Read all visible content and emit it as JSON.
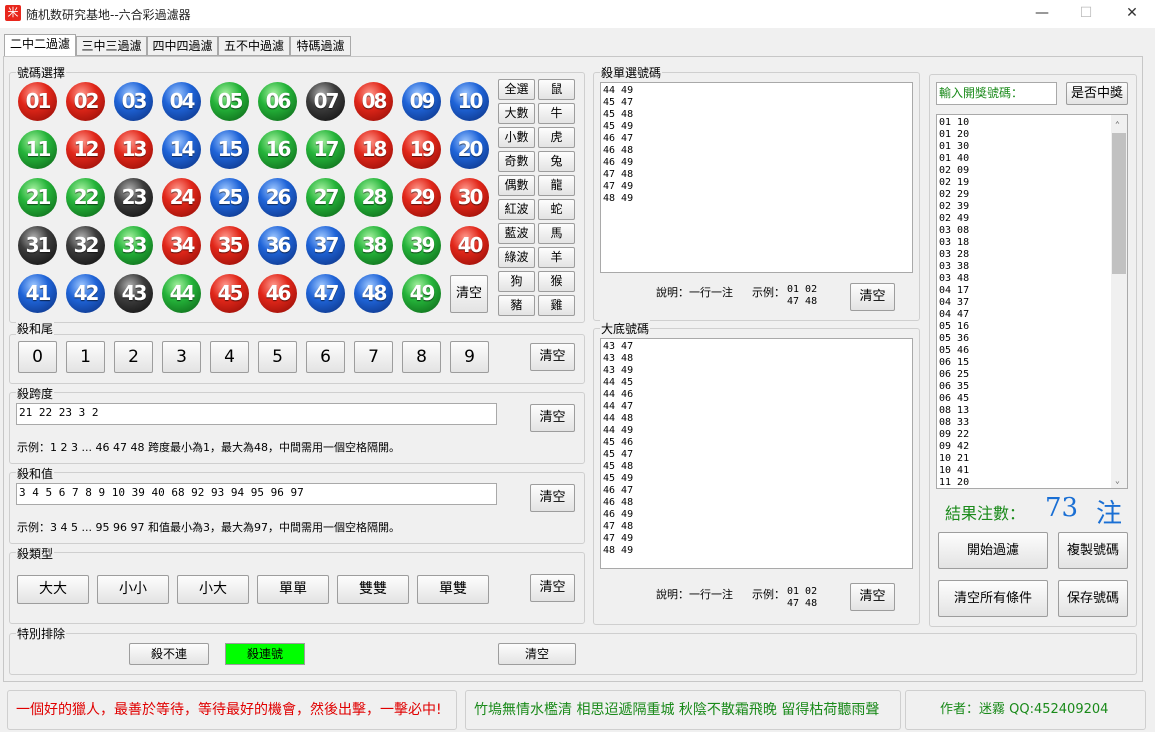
{
  "app": {
    "icon_glyph": "米",
    "title": "随机数研究基地--六合彩過濾器",
    "minimize_glyph": "—",
    "maximize_glyph": "☐",
    "close_glyph": "✕"
  },
  "tabs": [
    "二中二過濾",
    "三中三過濾",
    "四中四過濾",
    "五不中過濾",
    "特碼過濾"
  ],
  "number_select": {
    "label": "號碼選擇",
    "balls": [
      {
        "n": "01",
        "c": "red"
      },
      {
        "n": "02",
        "c": "red"
      },
      {
        "n": "03",
        "c": "blue"
      },
      {
        "n": "04",
        "c": "blue"
      },
      {
        "n": "05",
        "c": "green"
      },
      {
        "n": "06",
        "c": "green"
      },
      {
        "n": "07",
        "c": "black"
      },
      {
        "n": "08",
        "c": "red"
      },
      {
        "n": "09",
        "c": "blue"
      },
      {
        "n": "10",
        "c": "blue"
      },
      {
        "n": "11",
        "c": "green"
      },
      {
        "n": "12",
        "c": "red"
      },
      {
        "n": "13",
        "c": "red"
      },
      {
        "n": "14",
        "c": "blue"
      },
      {
        "n": "15",
        "c": "blue"
      },
      {
        "n": "16",
        "c": "green"
      },
      {
        "n": "17",
        "c": "green"
      },
      {
        "n": "18",
        "c": "red"
      },
      {
        "n": "19",
        "c": "red"
      },
      {
        "n": "20",
        "c": "blue"
      },
      {
        "n": "21",
        "c": "green"
      },
      {
        "n": "22",
        "c": "green"
      },
      {
        "n": "23",
        "c": "black"
      },
      {
        "n": "24",
        "c": "red"
      },
      {
        "n": "25",
        "c": "blue"
      },
      {
        "n": "26",
        "c": "blue"
      },
      {
        "n": "27",
        "c": "green"
      },
      {
        "n": "28",
        "c": "green"
      },
      {
        "n": "29",
        "c": "red"
      },
      {
        "n": "30",
        "c": "red"
      },
      {
        "n": "31",
        "c": "black"
      },
      {
        "n": "32",
        "c": "black"
      },
      {
        "n": "33",
        "c": "green"
      },
      {
        "n": "34",
        "c": "red"
      },
      {
        "n": "35",
        "c": "red"
      },
      {
        "n": "36",
        "c": "blue"
      },
      {
        "n": "37",
        "c": "blue"
      },
      {
        "n": "38",
        "c": "green"
      },
      {
        "n": "39",
        "c": "green"
      },
      {
        "n": "40",
        "c": "red"
      },
      {
        "n": "41",
        "c": "blue"
      },
      {
        "n": "42",
        "c": "blue"
      },
      {
        "n": "43",
        "c": "black"
      },
      {
        "n": "44",
        "c": "green"
      },
      {
        "n": "45",
        "c": "red"
      },
      {
        "n": "46",
        "c": "red"
      },
      {
        "n": "47",
        "c": "blue"
      },
      {
        "n": "48",
        "c": "blue"
      },
      {
        "n": "49",
        "c": "green"
      }
    ],
    "clear_label": "清空",
    "group_buttons": [
      "全選",
      "鼠",
      "大數",
      "牛",
      "小數",
      "虎",
      "奇數",
      "兔",
      "偶數",
      "龍",
      "紅波",
      "蛇",
      "藍波",
      "馬",
      "綠波",
      "羊",
      "狗",
      "猴",
      "豬",
      "雞"
    ]
  },
  "kill_tail": {
    "label": "殺和尾",
    "digits": [
      "0",
      "1",
      "2",
      "3",
      "4",
      "5",
      "6",
      "7",
      "8",
      "9"
    ],
    "clear_label": "清空"
  },
  "kill_span": {
    "label": "殺跨度",
    "value": "21 22 23 3 2",
    "clear_label": "清空",
    "note": "示例：1 2 3 ... 46 47 48 跨度最小為1，最大為48，中間需用一個空格隔開。"
  },
  "kill_sum": {
    "label": "殺和值",
    "value": "3 4 5 6 7 8 9 10 39 40 68 92 93 94 95 96 97",
    "clear_label": "清空",
    "note": "示例：3 4 5 ... 95 96 97 和值最小為3，最大為97，中間需用一個空格隔開。"
  },
  "kill_type": {
    "label": "殺類型",
    "buttons": [
      "大大",
      "小小",
      "小大",
      "單單",
      "雙雙",
      "單雙"
    ],
    "clear_label": "清空"
  },
  "special_exclude": {
    "label": "特別排除",
    "no_consecutive_label": "殺不連",
    "consecutive_label": "殺連號",
    "consecutive_color": "#00ff00",
    "clear_label": "清空"
  },
  "kill_single": {
    "label": "殺單選號碼",
    "lines": [
      "44 49",
      "45 47",
      "45 48",
      "45 49",
      "46 47",
      "46 48",
      "46 49",
      "47 48",
      "47 49",
      "48 49"
    ],
    "note_label": "說明：一行一注",
    "example_label": "示例：",
    "example_line1": "01 02",
    "example_line2": "47 48",
    "clear_label": "清空"
  },
  "base_numbers": {
    "label": "大底號碼",
    "lines": [
      "43 47",
      "43 48",
      "43 49",
      "44 45",
      "44 46",
      "44 47",
      "44 48",
      "44 49",
      "45 46",
      "45 47",
      "45 48",
      "45 49",
      "46 47",
      "46 48",
      "46 49",
      "47 48",
      "47 49",
      "48 49"
    ],
    "note_label": "說明：一行一注",
    "example_label": "示例：",
    "example_line1": "01 02",
    "example_line2": "47 48",
    "clear_label": "清空"
  },
  "result_panel": {
    "input_placeholder": "輸入開獎號碼：",
    "check_label": "是否中獎",
    "lines": [
      "01 10",
      "01 20",
      "01 30",
      "01 40",
      "02 09",
      "02 19",
      "02 29",
      "02 39",
      "02 49",
      "03 08",
      "03 18",
      "03 28",
      "03 38",
      "03 48",
      "04 17",
      "04 37",
      "04 47",
      "05 16",
      "05 36",
      "05 46",
      "06 15",
      "06 25",
      "06 35",
      "06 45",
      "08 13",
      "08 33",
      "09 22",
      "09 42",
      "10 21",
      "10 41",
      "11 20"
    ],
    "count_label": "結果注數：",
    "count_value": "73",
    "count_unit": "注",
    "count_color": "#1a6fd4",
    "start_label": "開始過濾",
    "copy_label": "複製號碼",
    "clear_all_label": "清空所有條件",
    "save_label": "保存號碼"
  },
  "footer": {
    "motto": "一個好的獵人，最善於等待，等待最好的機會，然後出擊，一擊必中!",
    "motto_color": "#e00000",
    "poem": "竹塢無情水檻清 相思迢遞隔重城 秋陰不散霜飛晚 留得枯荷聽雨聲",
    "poem_color": "#1a8a1a",
    "author": "作者：迷霧   QQ:452409204",
    "author_color": "#1a8a1a"
  }
}
